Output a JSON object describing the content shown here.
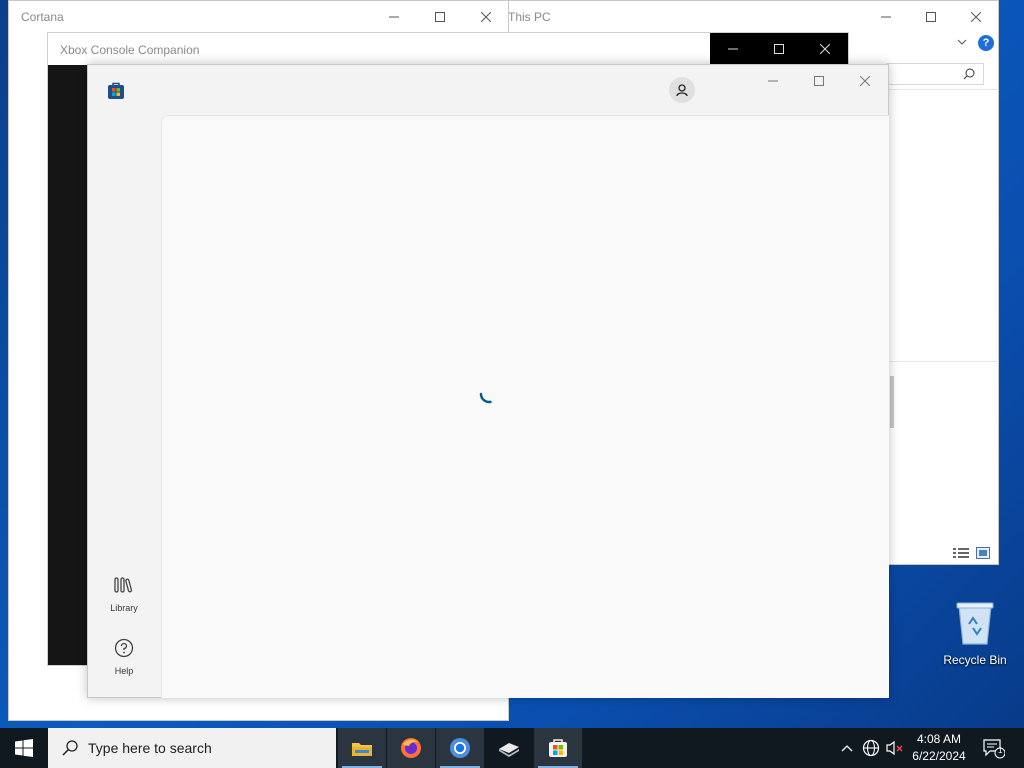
{
  "windows": {
    "this_pc": {
      "title": "This PC"
    },
    "cortana": {
      "title": "Cortana"
    },
    "xbox": {
      "title": "Xbox Console Companion"
    },
    "store": {
      "nav": [
        {
          "label": "Library",
          "icon": "library-icon"
        },
        {
          "label": "Help",
          "icon": "help-icon"
        }
      ]
    }
  },
  "desktop": {
    "recycle_bin": {
      "label": "Recycle Bin"
    }
  },
  "taskbar": {
    "search_placeholder": "Type here to search",
    "apps": [
      "file-explorer-icon",
      "firefox-icon",
      "chrome-icon",
      "app-icon",
      "microsoft-store-icon"
    ],
    "clock": {
      "time": "4:08 AM",
      "date": "6/22/2024"
    },
    "notification_count": "1"
  },
  "colors": {
    "accent": "#0a5bd6",
    "help_blue": "#1e6fd9",
    "spinner": "#0a5a8a"
  }
}
